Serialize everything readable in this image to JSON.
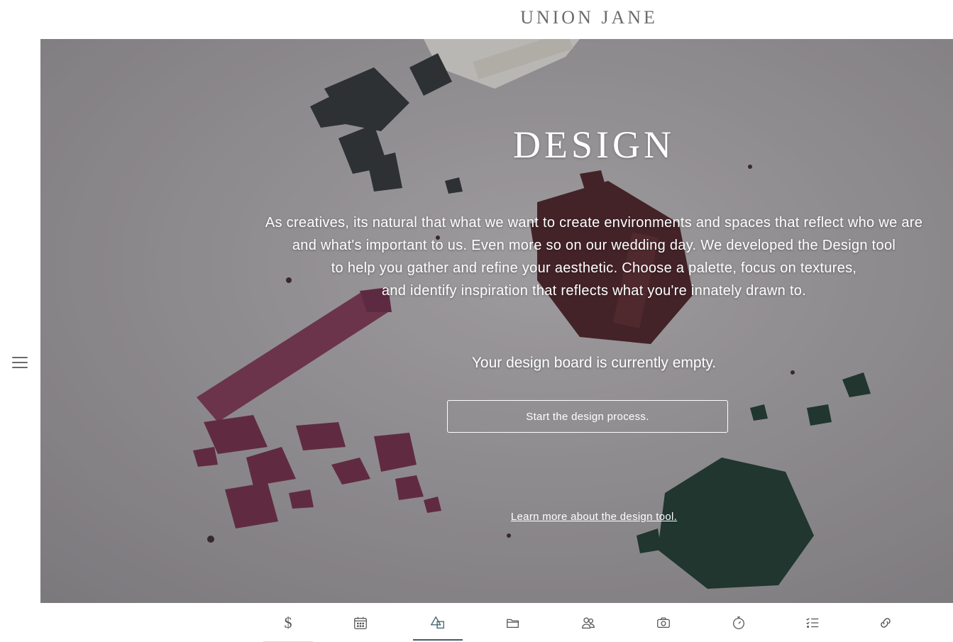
{
  "brand": {
    "name": "UNION JANE"
  },
  "hero": {
    "title": "DESIGN",
    "description_lines": [
      "As creatives, its natural that what we want to create environments and spaces that reflect who we are",
      "and what's important to us. Even more so on our wedding day. We developed the Design tool",
      "to help you gather and refine your aesthetic. Choose a palette, focus on textures,",
      "and identify inspiration that reflects what you're innately drawn to."
    ],
    "empty_note": "Your design board is currently empty.",
    "start_button": "Start the design process.",
    "learn_link": "Learn more about the design tool."
  },
  "left_rail": {
    "menu_icon": "hamburger-menu-icon"
  },
  "bottom_nav": {
    "items": [
      {
        "icon": "dollar-icon",
        "glyph": "$",
        "active": false
      },
      {
        "icon": "calendar-icon",
        "active": false
      },
      {
        "icon": "design-shapes-icon",
        "active": true
      },
      {
        "icon": "folder-icon",
        "active": false
      },
      {
        "icon": "people-icon",
        "active": false
      },
      {
        "icon": "camera-icon",
        "active": false
      },
      {
        "icon": "stopwatch-icon",
        "active": false
      },
      {
        "icon": "checklist-icon",
        "active": false
      },
      {
        "icon": "link-icon",
        "active": false
      }
    ],
    "accent_color": "#3f5e6b"
  }
}
